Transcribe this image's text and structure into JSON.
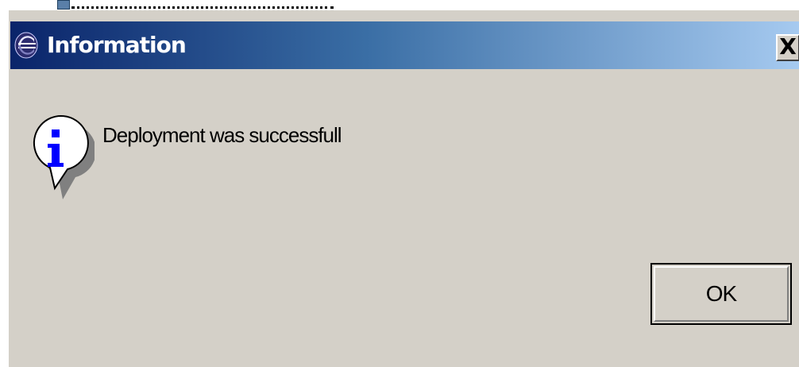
{
  "dialog": {
    "title": "Information",
    "title_icon": "eclipse-icon",
    "close_label": "X",
    "message_icon": "info-icon",
    "message": "Deployment was successfull",
    "ok_label": "OK"
  },
  "colors": {
    "titlebar_start": "#0a246a",
    "titlebar_end": "#a6caf0",
    "dialog_face": "#d4d0c8",
    "info_blue": "#0000ff"
  }
}
